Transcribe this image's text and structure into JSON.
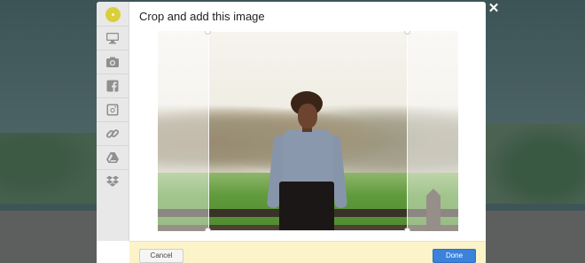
{
  "modal": {
    "title": "Crop and add this image",
    "close_icon": "close-icon",
    "logo_icon": "logo-icon"
  },
  "sidebar": {
    "items": [
      {
        "name": "computer",
        "icon": "monitor-icon"
      },
      {
        "name": "camera",
        "icon": "camera-icon"
      },
      {
        "name": "facebook",
        "icon": "facebook-icon"
      },
      {
        "name": "instagram",
        "icon": "instagram-icon"
      },
      {
        "name": "link",
        "icon": "link-icon"
      },
      {
        "name": "google-drive",
        "icon": "google-drive-icon"
      },
      {
        "name": "dropbox",
        "icon": "dropbox-icon"
      }
    ]
  },
  "footer": {
    "cancel_label": "Cancel",
    "done_label": "Done"
  },
  "colors": {
    "accent": "#3b82db",
    "footer_bg": "#fcf3c9",
    "sidebar_bg": "#e8e8e8",
    "logo": "#d9cf3c"
  }
}
